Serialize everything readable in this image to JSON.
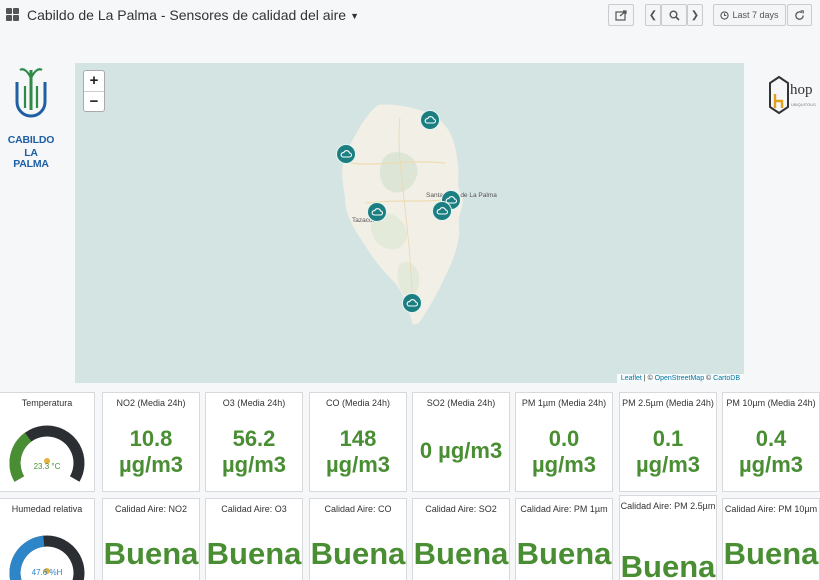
{
  "header": {
    "title": "Cabildo de La Palma - Sensores de calidad del aire",
    "time_range_label": "Last 7 days"
  },
  "logo_left": {
    "line1": "CABILDO",
    "line2": "LA PALMA"
  },
  "logo_right": {
    "text": "hop",
    "subtext": "UBIQUITOUS"
  },
  "map": {
    "zoom_in": "+",
    "zoom_out": "−",
    "place_labels": [
      "Santa Cruz de La Palma",
      "Tazacorte"
    ],
    "attribution": {
      "leaflet": "Leaflet",
      "sep": " | © ",
      "osm": "OpenStreetMap",
      "sep2": " © ",
      "carto": "CartoDB"
    },
    "marker_color": "#1b7f82",
    "markers": [
      "cloud-marker",
      "cloud-marker",
      "cloud-marker",
      "cloud-marker",
      "cloud-marker",
      "cloud-marker"
    ]
  },
  "row1": {
    "temperatura": {
      "title": "Temperatura",
      "value": "23.3 °C",
      "level": 0.35,
      "color": "#4a8e34"
    },
    "panels": [
      {
        "title": "NO2 (Media 24h)",
        "value": "10.8",
        "unit": "µg/m3"
      },
      {
        "title": "O3 (Media 24h)",
        "value": "56.2",
        "unit": "µg/m3"
      },
      {
        "title": "CO (Media 24h)",
        "value": "148",
        "unit": "µg/m3"
      },
      {
        "title": "SO2 (Media 24h)",
        "value": "0 µg/m3",
        "unit": ""
      },
      {
        "title": "PM 1µm (Media 24h)",
        "value": "0.0",
        "unit": "µg/m3"
      },
      {
        "title": "PM 2.5µm (Media 24h)",
        "value": "0.1",
        "unit": "µg/m3"
      },
      {
        "title": "PM 10µm (Media 24h)",
        "value": "0.4",
        "unit": "µg/m3"
      }
    ]
  },
  "row2": {
    "humedad": {
      "title": "Humedad relativa",
      "value": "47.6 %H",
      "level": 0.476,
      "color": "#2e86c8"
    },
    "panels": [
      {
        "title": "Calidad Aire: NO2",
        "value": "Buena"
      },
      {
        "title": "Calidad Aire: O3",
        "value": "Buena"
      },
      {
        "title": "Calidad Aire: CO",
        "value": "Buena"
      },
      {
        "title": "Calidad Aire: SO2",
        "value": "Buena"
      },
      {
        "title": "Calidad Aire: PM 1µm",
        "value": "Buena"
      },
      {
        "title": "Calidad Aire: PM 2.5µm",
        "value": "Buena"
      },
      {
        "title": "Calidad Aire: PM 10µm",
        "value": "Buena"
      }
    ]
  },
  "colors": {
    "good": "#4a8e34",
    "gauge_track": "#2b2f33"
  }
}
